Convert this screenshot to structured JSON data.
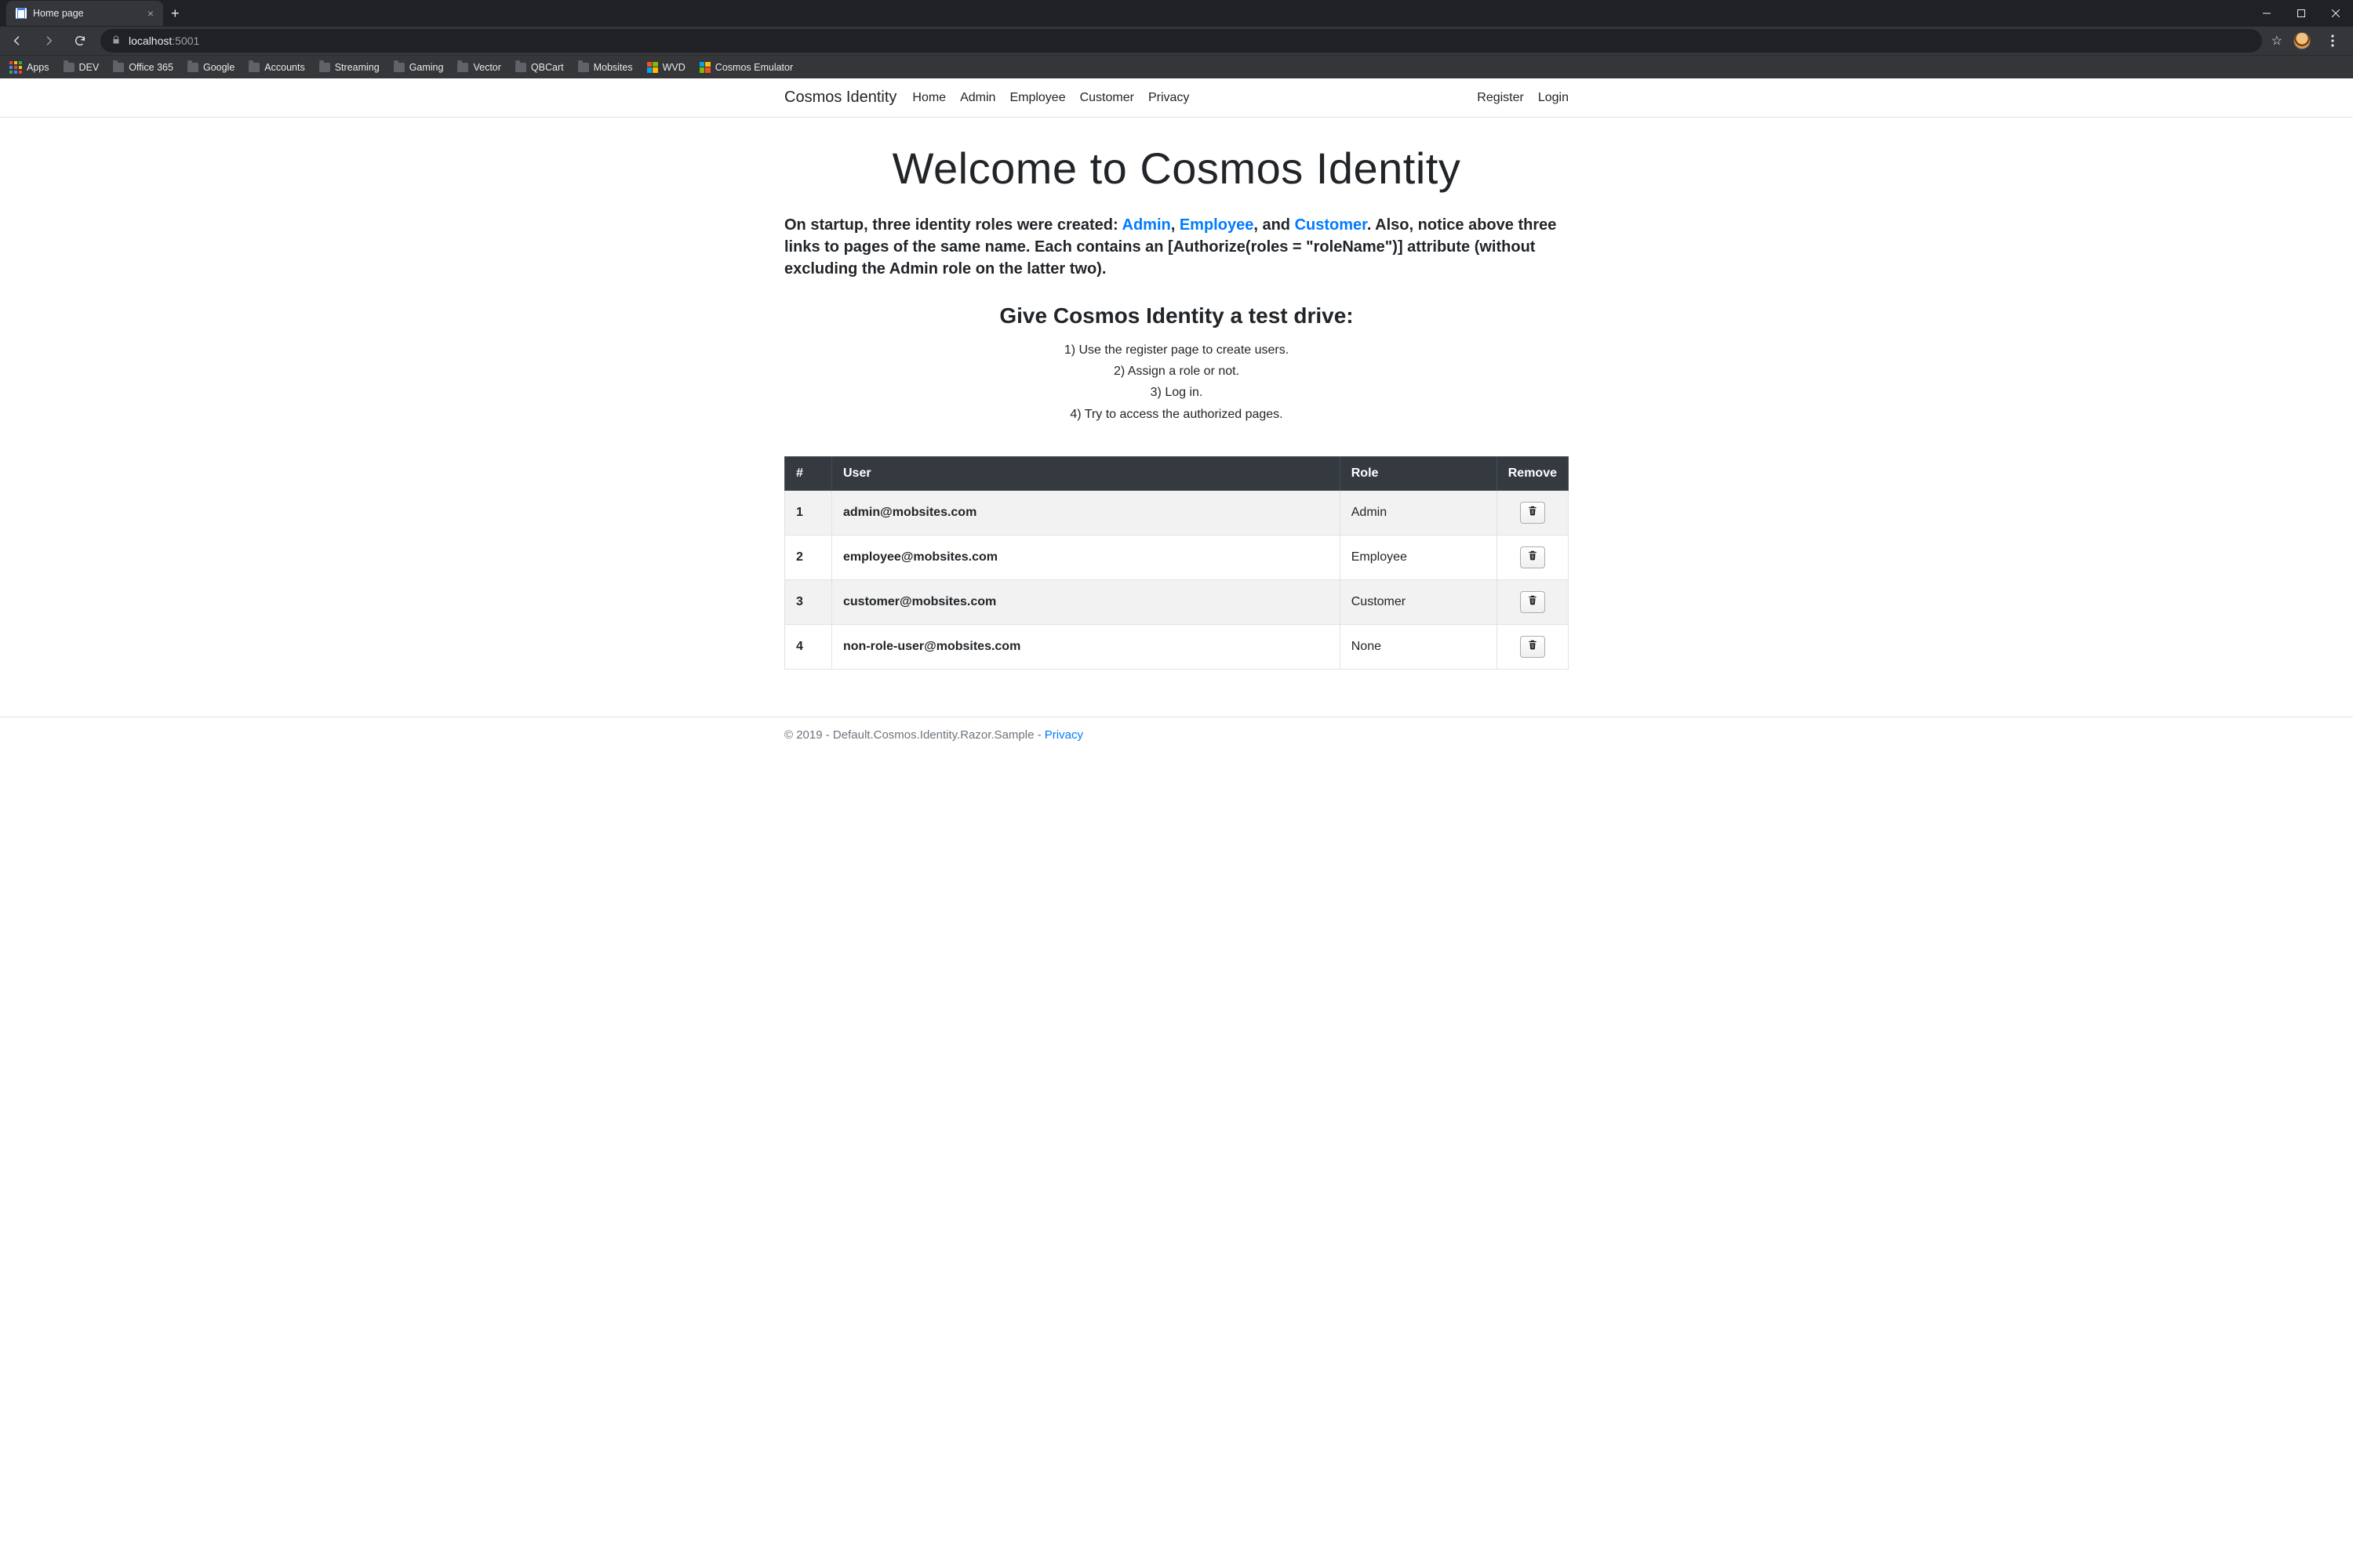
{
  "browser": {
    "tab_title": "Home page",
    "url_host": "localhost",
    "url_port": ":5001",
    "apps_label": "Apps",
    "bookmarks": [
      {
        "type": "folder",
        "label": "DEV"
      },
      {
        "type": "folder",
        "label": "Office 365"
      },
      {
        "type": "folder",
        "label": "Google"
      },
      {
        "type": "folder",
        "label": "Accounts"
      },
      {
        "type": "folder",
        "label": "Streaming"
      },
      {
        "type": "folder",
        "label": "Gaming"
      },
      {
        "type": "folder",
        "label": "Vector"
      },
      {
        "type": "folder",
        "label": "QBCart"
      },
      {
        "type": "folder",
        "label": "Mobsites"
      },
      {
        "type": "ms",
        "label": "WVD"
      },
      {
        "type": "cosmos",
        "label": "Cosmos Emulator"
      }
    ]
  },
  "navbar": {
    "brand": "Cosmos Identity",
    "links": [
      "Home",
      "Admin",
      "Employee",
      "Customer",
      "Privacy"
    ],
    "right": [
      "Register",
      "Login"
    ]
  },
  "hero": {
    "title": "Welcome to Cosmos Identity",
    "intro_parts": {
      "p1": "On startup, three identity roles were created: ",
      "admin": "Admin",
      "sep1": ", ",
      "employee": "Employee",
      "sep2": ", and ",
      "customer": "Customer",
      "p2": ". Also, notice above three links to pages of the same name. Each contains an [Authorize(roles = \"roleName\")] attribute (without excluding the Admin role on the latter two)."
    },
    "subtitle": "Give Cosmos Identity a test drive:",
    "steps": [
      "1) Use the register page to create users.",
      "2) Assign a role or not.",
      "3) Log in.",
      "4) Try to access the authorized pages."
    ]
  },
  "table": {
    "headers": {
      "num": "#",
      "user": "User",
      "role": "Role",
      "remove": "Remove"
    },
    "rows": [
      {
        "n": "1",
        "user": "admin@mobsites.com",
        "role": "Admin"
      },
      {
        "n": "2",
        "user": "employee@mobsites.com",
        "role": "Employee"
      },
      {
        "n": "3",
        "user": "customer@mobsites.com",
        "role": "Customer"
      },
      {
        "n": "4",
        "user": "non-role-user@mobsites.com",
        "role": "None"
      }
    ]
  },
  "footer": {
    "text": "© 2019 - Default.Cosmos.Identity.Razor.Sample - ",
    "link": "Privacy"
  }
}
